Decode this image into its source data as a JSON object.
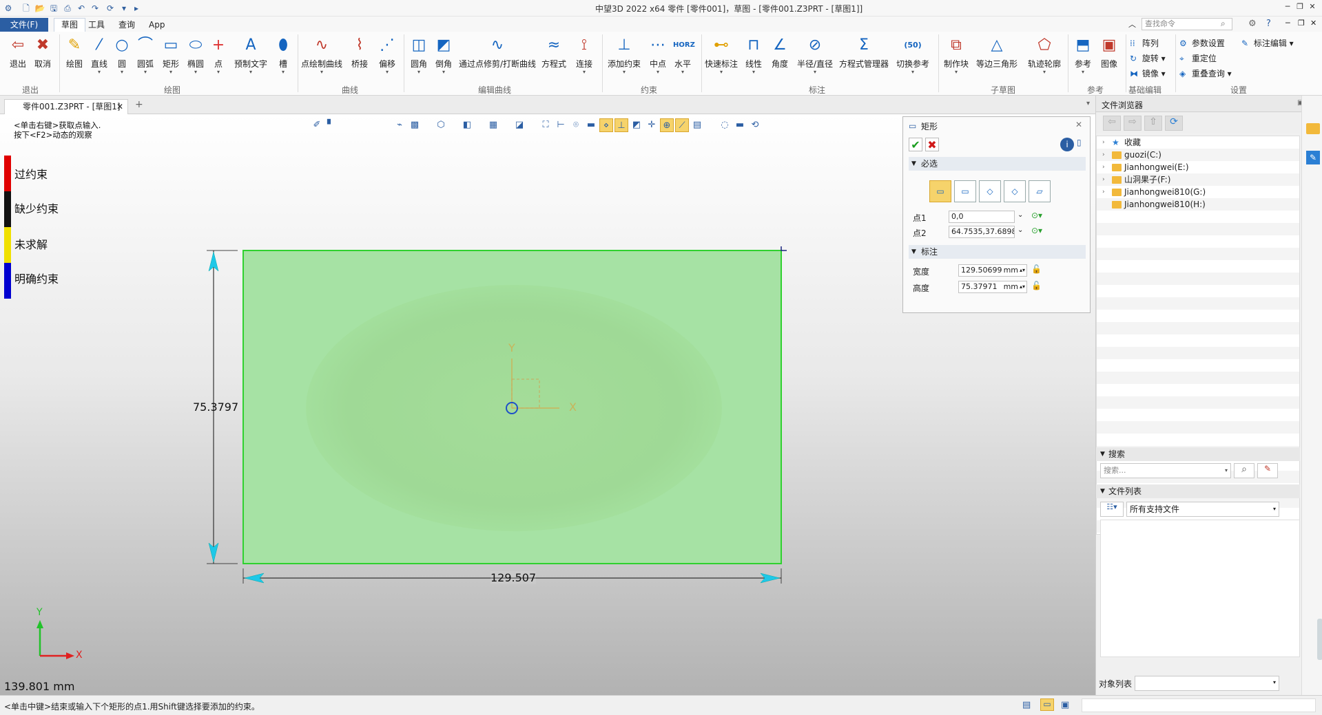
{
  "window": {
    "title": "中望3D 2022 x64      零件 [零件001]，草图 - [零件001.Z3PRT - [草图1]]",
    "search_placeholder": "查找命令"
  },
  "menu": {
    "file": "文件(F)",
    "sketch": "草图",
    "tools": "工具",
    "query": "查询",
    "app": "App"
  },
  "ribbon": {
    "groups": {
      "exit": "退出",
      "draw": "绘图",
      "curve": "曲线",
      "edit_curve": "编辑曲线",
      "constraint": "约束",
      "dimension": "标注",
      "sub_sketch": "子草图",
      "reference": "参考",
      "basic_edit": "基础编辑",
      "settings": "设置"
    },
    "buttons": {
      "exit": "退出",
      "cancel": "取消",
      "draw": "绘图",
      "line": "直线",
      "circle": "圆",
      "arc": "圆弧",
      "rect": "矩形",
      "ellipse": "椭圆",
      "point": "点",
      "text": "预制文字",
      "slot": "槽",
      "point_curve": "点绘制曲线",
      "bridge": "桥接",
      "offset": "偏移",
      "fillet": "圆角",
      "chamfer": "倒角",
      "trim": "通过点修剪/打断曲线",
      "equation": "方程式",
      "connect": "连接",
      "add_constraint": "添加约束",
      "midpoint": "中点",
      "horizontal": "水平",
      "quick_dim": "快速标注",
      "linear": "线性",
      "angle": "角度",
      "radius": "半径/直径",
      "equation_mgr": "方程式管理器",
      "switch_ref": "切换参考",
      "make_block": "制作块",
      "equilateral": "等边三角形",
      "track_profile": "轨迹轮廓",
      "ref": "参考",
      "image": "图像",
      "array": "阵列",
      "rotate": "旋转",
      "mirror": "镜像",
      "param_settings": "参数设置",
      "relocate": "重定位",
      "overlap_query": "重叠查询",
      "dim_edit": "标注编辑"
    },
    "horz_badge": "HORZ",
    "switch_badge": "(50)"
  },
  "doc_tab": {
    "label": "零件001.Z3PRT - [草图1]"
  },
  "viewport": {
    "hint_line1": "<单击右键>获取点输入.",
    "hint_line2": "按下<F2>动态的观察",
    "legend": [
      {
        "label": "过约束",
        "color": "#e00000"
      },
      {
        "label": "缺少约束",
        "color": "#111111"
      },
      {
        "label": "未求解",
        "color": "#f0e000"
      },
      {
        "label": "明确约束",
        "color": "#0000d0"
      }
    ],
    "dim_height": "75.3797",
    "dim_width": "129.507",
    "axis_x": "X",
    "axis_y": "Y",
    "triad_x": "X",
    "triad_y": "Y",
    "zoom": "139.801 mm"
  },
  "dialog": {
    "title": "矩形",
    "section_required": "必选",
    "point1_label": "点1",
    "point1_value": "0,0",
    "point2_label": "点2",
    "point2_value": "64.7535,37.6898",
    "section_dim": "标注",
    "width_label": "宽度",
    "width_value": "129.50699",
    "height_label": "高度",
    "height_value": "75.37971",
    "unit": "mm"
  },
  "browser": {
    "title": "文件浏览器",
    "favorites": "收藏",
    "drives": [
      "guozi(C:)",
      "Jianhongwei(E:)",
      "山洞果子(F:)",
      "Jianhongwei810(G:)",
      "Jianhongwei810(H:)"
    ],
    "search_title": "搜索",
    "search_placeholder": "搜索...",
    "filelist_title": "文件列表",
    "filter": "所有支持文件",
    "object_list": "对象列表"
  },
  "status": {
    "text": "<单击中键>结束或输入下个矩形的点1.用Shift键选择要添加的约束。"
  },
  "colors": {
    "rect_fill": "#a6e2a4",
    "rect_border": "#2fd12f",
    "dim_arrow": "#1ec8e8",
    "accent": "#2b5ea3"
  }
}
